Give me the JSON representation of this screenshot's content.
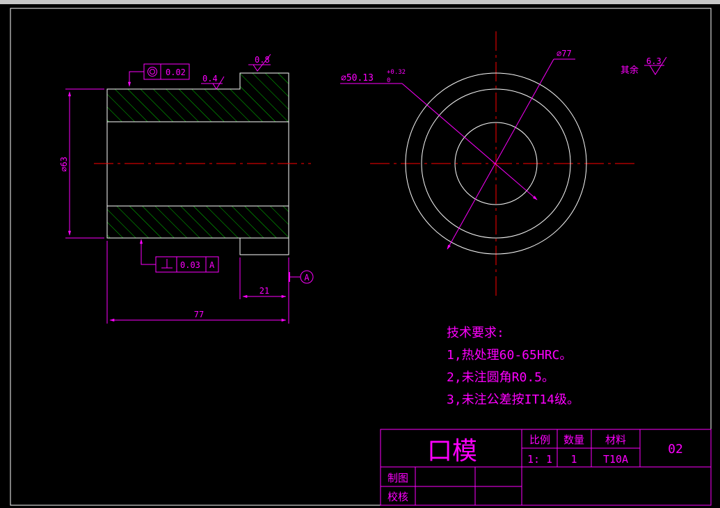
{
  "colors": {
    "background": "#000000",
    "outline": "#ffffff",
    "dimension": "#ff00ff",
    "centerline": "#ff0000",
    "hatch": "#00cc00"
  },
  "side_view": {
    "diameter_label": "⌀63",
    "length_label": "77",
    "step_label": "21",
    "roughness_top_right": "0.8",
    "roughness_top": "0.4",
    "concentricity_tolerance": "0.02",
    "perpendicularity_tolerance": "0.03",
    "perpendicularity_datum": "A",
    "datum_label": "A"
  },
  "end_view": {
    "bore_label": "⌀50.13",
    "bore_tol_upper": "+0.32",
    "bore_tol_lower": "0",
    "outer_label": "⌀77",
    "rest_roughness_label": "其余",
    "rest_roughness_value": "6.3"
  },
  "notes": {
    "title": "技术要求:",
    "items": [
      "1,热处理60-65HRC。",
      "2,未注圆角R0.5。",
      "3,未注公差按IT14级。"
    ]
  },
  "title_block": {
    "part_name": "口模",
    "scale_header": "比例",
    "quantity_header": "数量",
    "material_header": "材料",
    "scale_value": "1: 1",
    "quantity_value": "1",
    "material_value": "T10A",
    "drawing_number": "02",
    "drawn_label": "制图",
    "checked_label": "校核"
  }
}
